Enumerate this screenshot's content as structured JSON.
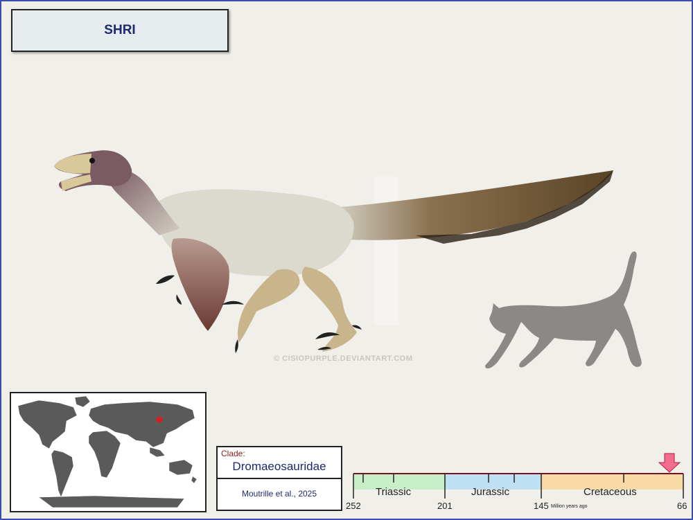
{
  "title": "SHRI",
  "watermark": "© CISIOPURPLE.DEVIANTART.COM",
  "clade": {
    "label": "Clade:",
    "name": "Dromaeosauridae",
    "citation": "Moutrille et al., 2025"
  },
  "timeline": {
    "periods": [
      {
        "name": "Triassic",
        "color": "#c8eec8"
      },
      {
        "name": "Jurassic",
        "color": "#bfe0f2"
      },
      {
        "name": "Cretaceous",
        "color": "#f9d9a6"
      }
    ],
    "boundaries": [
      "252",
      "201",
      "145",
      "66"
    ],
    "unit_label": "Million years ago"
  },
  "colors": {
    "frame": "#3a4cb0",
    "title_text": "#1d2a6e",
    "marker": "#f26d8f",
    "location_dot": "#d91c1c"
  }
}
